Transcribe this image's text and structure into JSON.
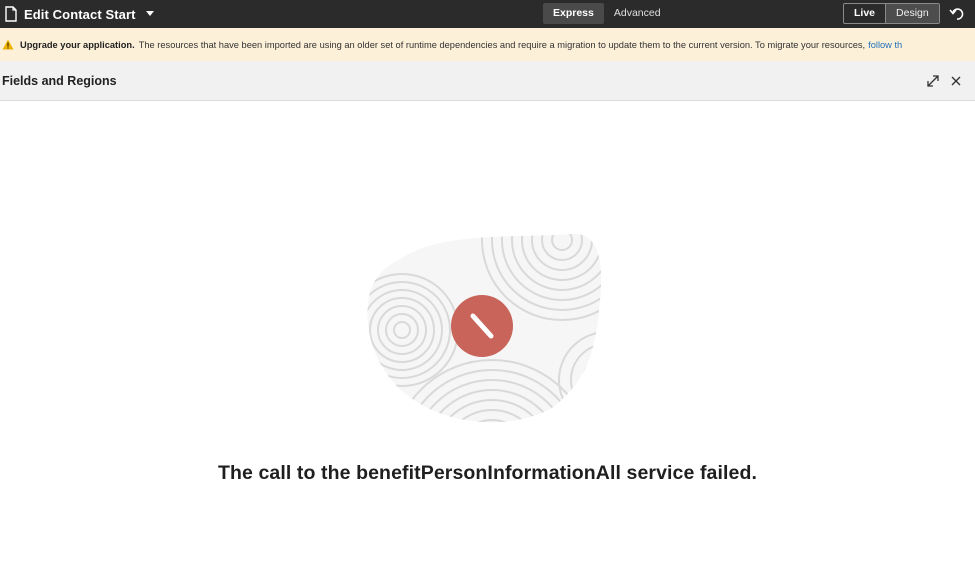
{
  "header": {
    "page_title": "Edit Contact Start",
    "modes": [
      "Express",
      "Advanced"
    ],
    "active_mode": "Express",
    "views": [
      "Live",
      "Design"
    ],
    "active_view": "Design"
  },
  "banner": {
    "bold": "Upgrade your application.",
    "text": "The resources that have been imported are using an older set of runtime dependencies and require a migration to update them to the current version. To migrate your resources,",
    "link": "follow th",
    "icon": "warning-icon",
    "background": "#fdf0d8"
  },
  "panel": {
    "title": "Fields and Regions"
  },
  "error": {
    "message": "The call to the benefitPersonInformationAll service failed.",
    "badge_color": "#c8645a"
  },
  "colors": {
    "toolbar": "#2b2b2b",
    "link": "#1f6fb8"
  }
}
